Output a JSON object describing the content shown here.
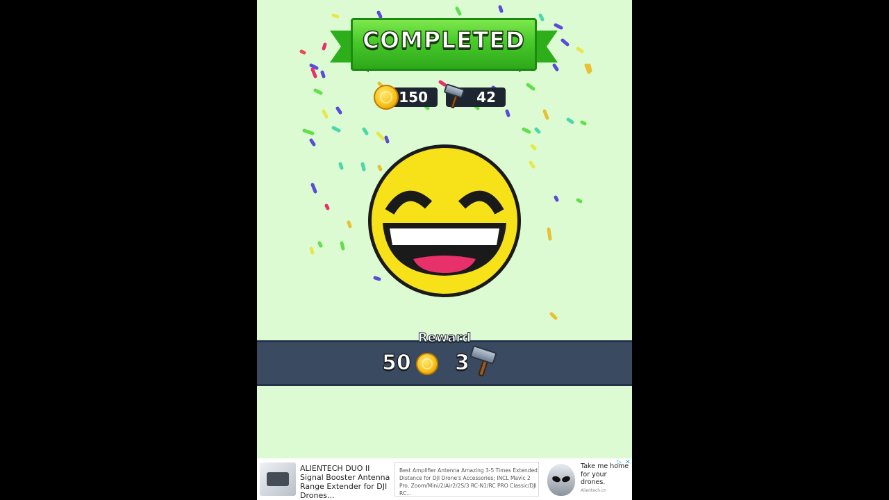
{
  "level_complete": {
    "banner_title": "COMPLETED",
    "colors": {
      "banner_green": "#47c92a",
      "background": "#dcfbd3",
      "reward_bar": "#3a4a61",
      "smiley_yellow": "#f7e21a",
      "tongue": "#e8306a"
    }
  },
  "balance": {
    "coins": "150",
    "coin_icon": "coin-icon",
    "hammers": "42",
    "hammer_icon": "hammer-icon"
  },
  "reward": {
    "label": "Reward",
    "coins": "50",
    "hammers": "3"
  },
  "ad": {
    "title": "ALIENTECH DUO II Signal Booster Antenna Range Extender for DJI Drones...",
    "description": "Best Amplifier Antenna Amazing 3-5 Times Extended Distance for DJI Drone's Accessories; INCL Mavic 2 Pro, Zoom/Mini/2/Air2/2S/3 RC-N1/RC PRO Classic/DJI RC...",
    "cta": "Take me home for your drones.",
    "source": "Alientech.cn",
    "choices_icon": "adchoices-icon",
    "close_icon": "close-icon"
  }
}
